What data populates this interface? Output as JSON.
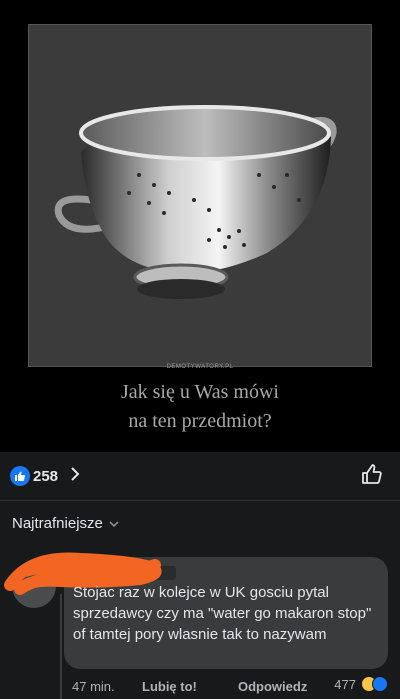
{
  "post": {
    "watermark": "DEMOTYWATORY.PL",
    "caption_line1": "Jak się u Was mówi",
    "caption_line2": "na ten przedmiot?",
    "image_subject": "colander"
  },
  "reactions": {
    "count": "258",
    "like_color": "#1877f2"
  },
  "comments_section": {
    "sort_label": "Najtrafniejsze"
  },
  "comment": {
    "text": "Stojac raz w kolejce w UK gosciu pytal sprzedawcy czy ma \"water go makaron stop\" of tamtej pory wlasnie tak to nazywam",
    "time": "47 min.",
    "like_action": "Lubię to!",
    "reply_action": "Odpowiedz",
    "reaction_count": "477"
  },
  "colors": {
    "background": "#18191a",
    "bubble": "#3a3b3c",
    "scribble": "#f26522",
    "accent": "#1877f2"
  }
}
